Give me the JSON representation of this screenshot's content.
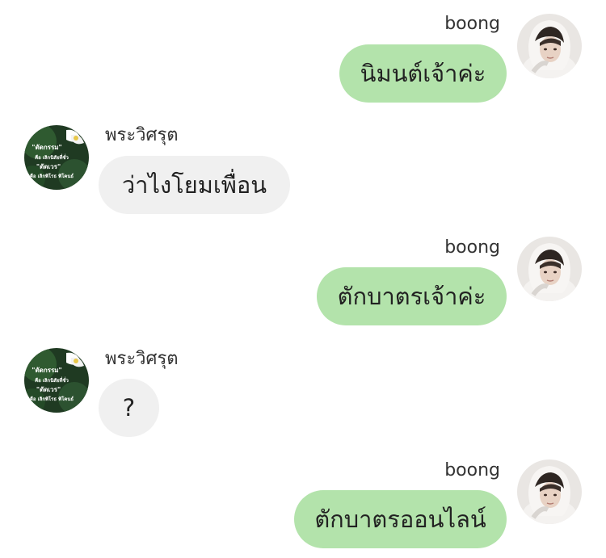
{
  "messages": [
    {
      "direction": "outgoing",
      "sender": "boong",
      "text": "นิมนต์เจ้าค่ะ"
    },
    {
      "direction": "incoming",
      "sender": "พระวิศรุต",
      "text": "ว่าไงโยมเพื่อน"
    },
    {
      "direction": "outgoing",
      "sender": "boong",
      "text": "ตักบาตรเจ้าค่ะ"
    },
    {
      "direction": "incoming",
      "sender": "พระวิศรุต",
      "text": "?"
    },
    {
      "direction": "outgoing",
      "sender": "boong",
      "text": "ตักบาตรออนไลน์"
    }
  ],
  "avatars": {
    "boong": {
      "icon": "profile-photo-hooded-person"
    },
    "monk": {
      "icon": "profile-photo-lotus-quote",
      "lines": [
        "\"ตัดกรรม\"",
        "คือ เลิกนิสัยที่ชั่ว",
        "\"ตัดเวร\"",
        "คือ เลิกพิโรธ พิโคนธ์"
      ]
    }
  },
  "colors": {
    "outgoing_bubble": "#b3e3ab",
    "incoming_bubble": "#f0f0f0",
    "background": "#ffffff",
    "name_text": "#333333",
    "message_text": "#222222"
  }
}
